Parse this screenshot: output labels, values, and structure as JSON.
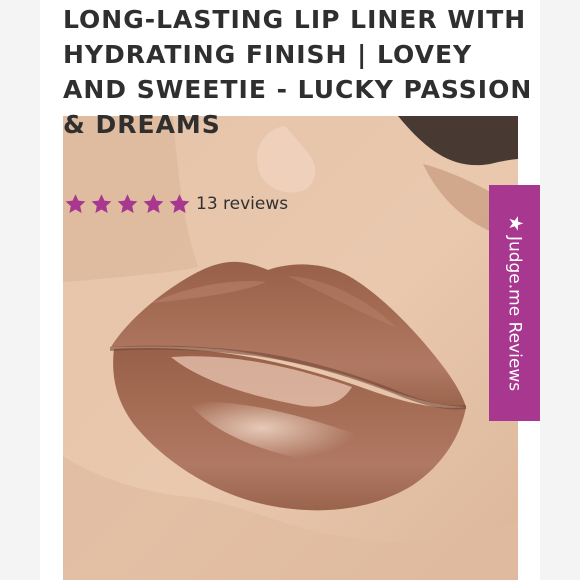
{
  "product": {
    "title": "LONG-LASTING LIP LINER WITH HYDRATING FINISH | LOVEY AND SWEETIE - LUCKY PASSION & DREAMS"
  },
  "rating": {
    "value": 5,
    "max": 5,
    "review_count_text": "13 reviews",
    "star_color": "#a7378f"
  },
  "sidebar_widget": {
    "label": "Judge.me Reviews",
    "icon": "star-icon",
    "background": "#a7378f"
  },
  "image": {
    "subject": "lip-closeup",
    "lip_color": "#a86f57"
  }
}
